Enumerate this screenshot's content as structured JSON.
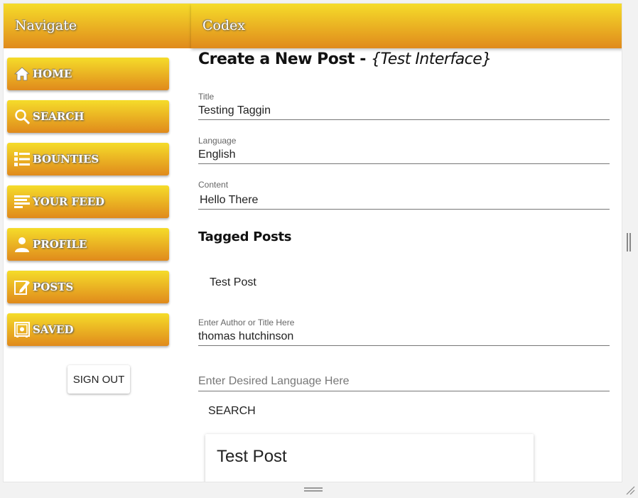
{
  "sidebar": {
    "header": "Navigate",
    "items": [
      {
        "label": "HOME",
        "icon": "home-icon"
      },
      {
        "label": "SEARCH",
        "icon": "search-icon"
      },
      {
        "label": "BOUNTIES",
        "icon": "list-icon"
      },
      {
        "label": "YOUR FEED",
        "icon": "feed-icon"
      },
      {
        "label": "PROFILE",
        "icon": "person-icon"
      },
      {
        "label": "POSTS",
        "icon": "edit-icon"
      },
      {
        "label": "SAVED",
        "icon": "safe-icon"
      }
    ],
    "signout_label": "SIGN OUT"
  },
  "header": {
    "title": "Codex"
  },
  "main": {
    "title_prefix": "Create a New Post - ",
    "title_emphasis": "{Test Interface}",
    "fields": {
      "title": {
        "label": "Title",
        "value": "Testing Taggin"
      },
      "language": {
        "label": "Language",
        "value": "English"
      },
      "content": {
        "label": "Content",
        "value": "Hello There"
      }
    },
    "tagged_posts": {
      "heading": "Tagged Posts",
      "items": [
        "Test Post"
      ]
    },
    "search": {
      "author": {
        "label": "Enter Author or Title Here",
        "value": "thomas hutchinson"
      },
      "language": {
        "placeholder": "Enter Desired Language Here"
      },
      "button_label": "SEARCH"
    },
    "results": [
      {
        "title": "Test Post"
      }
    ]
  },
  "colors": {
    "accent_top": "#f5dc2a",
    "accent_bottom": "#e08a1c"
  }
}
